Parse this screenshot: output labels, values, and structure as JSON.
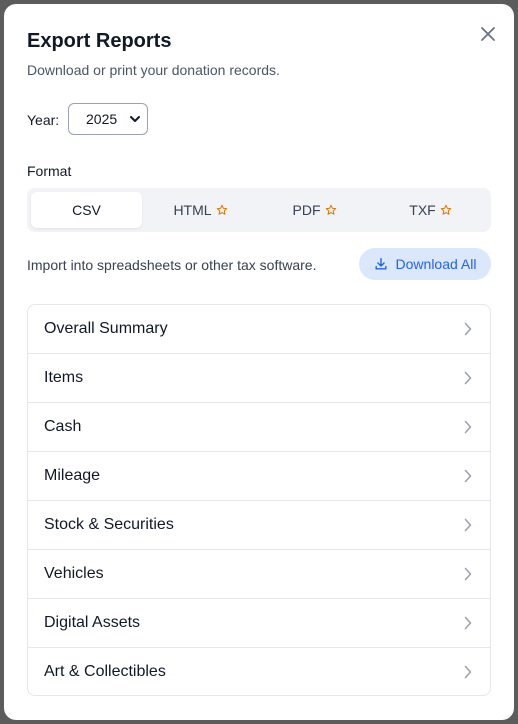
{
  "dialog": {
    "title": "Export Reports",
    "subtitle": "Download or print your donation records."
  },
  "year": {
    "label": "Year:",
    "selected": "2025"
  },
  "format": {
    "label": "Format",
    "options": [
      {
        "label": "CSV",
        "premium": false,
        "selected": true
      },
      {
        "label": "HTML",
        "premium": true,
        "selected": false
      },
      {
        "label": "PDF",
        "premium": true,
        "selected": false
      },
      {
        "label": "TXF",
        "premium": true,
        "selected": false
      }
    ]
  },
  "format_description": "Import into spreadsheets or other tax software.",
  "download_all": {
    "label": "Download All",
    "icon": "download-icon"
  },
  "reports": [
    "Overall Summary",
    "Items",
    "Cash",
    "Mileage",
    "Stock & Securities",
    "Vehicles",
    "Digital Assets",
    "Art & Collectibles"
  ],
  "colors": {
    "accent": "#2563eb",
    "accent_bg": "#dbe7fb",
    "star": "#d97706"
  }
}
